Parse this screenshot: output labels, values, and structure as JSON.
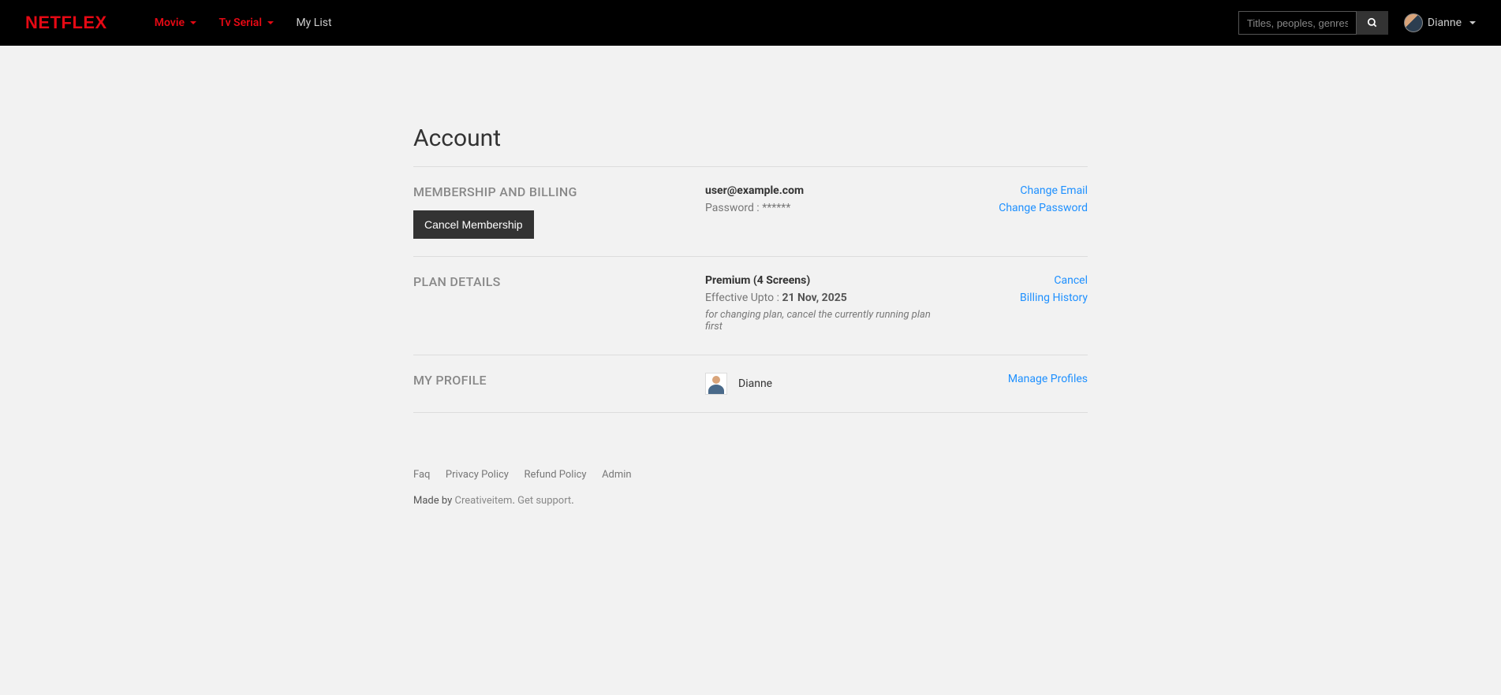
{
  "header": {
    "logo": "NETFLEX",
    "nav": {
      "movie": "Movie",
      "tvserial": "Tv Serial",
      "mylist": "My List"
    },
    "search": {
      "placeholder": "Titles, peoples, genres"
    },
    "user": {
      "name": "Dianne"
    }
  },
  "page": {
    "title": "Account",
    "membership": {
      "heading": "MEMBERSHIP AND BILLING",
      "cancel_btn": "Cancel Membership",
      "email": "user@example.com",
      "password_label": "Password : ",
      "password_mask": "******",
      "change_email": "Change Email",
      "change_password": "Change Password"
    },
    "plan": {
      "heading": "PLAN DETAILS",
      "plan_name": "Premium (4 Screens)",
      "effective_label": "Effective Upto : ",
      "effective_date": "21 Nov, 2025",
      "note": "for changing plan, cancel the currently running plan first",
      "cancel": "Cancel",
      "billing_history": "Billing History"
    },
    "profile": {
      "heading": "MY PROFILE",
      "name": "Dianne",
      "manage": "Manage Profiles"
    }
  },
  "footer": {
    "links": {
      "faq": "Faq",
      "privacy": "Privacy Policy",
      "refund": "Refund Policy",
      "admin": "Admin"
    },
    "made_by_prefix": "Made by ",
    "made_by_link": "Creativeitem",
    "made_by_sep": ". ",
    "support_link": "Get support",
    "made_by_end": "."
  }
}
